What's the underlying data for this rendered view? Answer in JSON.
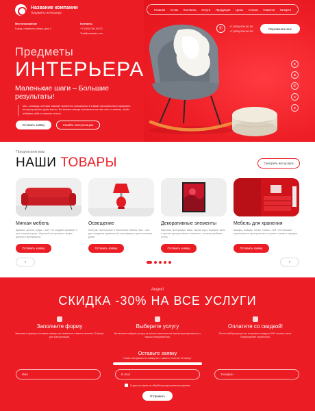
{
  "brand": {
    "name": "Название компании",
    "tagline": "Предметы интерьера"
  },
  "nav": [
    "Главная",
    "О нас",
    "Контакты",
    "Услуги",
    "Продукция",
    "Цены",
    "Статьи",
    "Новости",
    "Галерея"
  ],
  "contacts": {
    "address_label": "Местоположение",
    "address": "Город, название улицы, дом 1",
    "contacts_label": "Контакты",
    "phone": "+7 (000) 000-00-00",
    "email": "Text@example.com"
  },
  "phones": [
    "+7 (000) 000-00-00",
    "+7 (000) 000-00-00"
  ],
  "callback_label": "Перезвоните мне",
  "hero": {
    "subtitle": "Предметы",
    "title": "ИНТЕРЬЕРА",
    "tagline": "Маленькие шаги – Большие результаты!",
    "description": "Мы – команда, которая поможет привнести уникальность в ваше пространство и оформить интерьер вашего дома мечты. Вы можете всегда положиться на наш опыт и знания, чтобы избавить себя от лишних хлопот.",
    "btn_primary": "Оставить заявку",
    "btn_secondary": "Узнайте консультацию"
  },
  "products": {
    "eyebrow": "Предлагаем вам",
    "title_part1": "НАШИ",
    "title_part2": "ТОВАРЫ",
    "all_label": "Смотреть все услуги",
    "btn_label": "Оставить заявку",
    "items": [
      {
        "name": "Мягкая мебель",
        "desc": "Диваны, кресла, пуфы – всё, что создаёт комфорт и уют в вашем доме. Широкий ассортимент форм, цветов и материалов."
      },
      {
        "name": "Освещение",
        "desc": "Люстры, настольные и напольные лампы, бра – всё для создания правильной атмосферы и уюта в вашем доме."
      },
      {
        "name": "Декоративные элементы",
        "desc": "Картины, фоторамки, вазы, скульптуры, зеркала, часы и прочие декоративные элементы, которые добавят стиль."
      },
      {
        "name": "Мебель для хранения",
        "desc": "Шкафы, комоды, полки, тумбы – всё, что поможет организовать пространство и хранить вещи в порядке."
      }
    ]
  },
  "promo": {
    "eyebrow": "Акция!",
    "title": "СКИДКА -30% НА ВСЕ УСЛУГИ",
    "steps": [
      {
        "title": "Заполните форму",
        "desc": "Заполните форму и оставьте заявку, мы свяжемся с вами в течение 10 минут для консультации."
      },
      {
        "title": "Выберите услугу",
        "desc": "Вы можете выбрать услугу из нашего каталога или проконсультироваться с нашим специалистом."
      },
      {
        "title": "Оплатите со скидкой!",
        "desc": "После выбора услуги вы получаете скидку в 30% на весь заказ. Предложение ограничено."
      }
    ],
    "form_title": "Оставьте заявку",
    "form_sub": "Наши специалисты свяжутся с вами в течение 10 минут",
    "name_placeholder": "Имя",
    "email_placeholder": "E-mail",
    "phone_placeholder": "Телефон",
    "consent": "Я даю согласие на обработку персональных данных",
    "submit": "Отправить"
  },
  "colors": {
    "accent": "#ec1c24"
  }
}
